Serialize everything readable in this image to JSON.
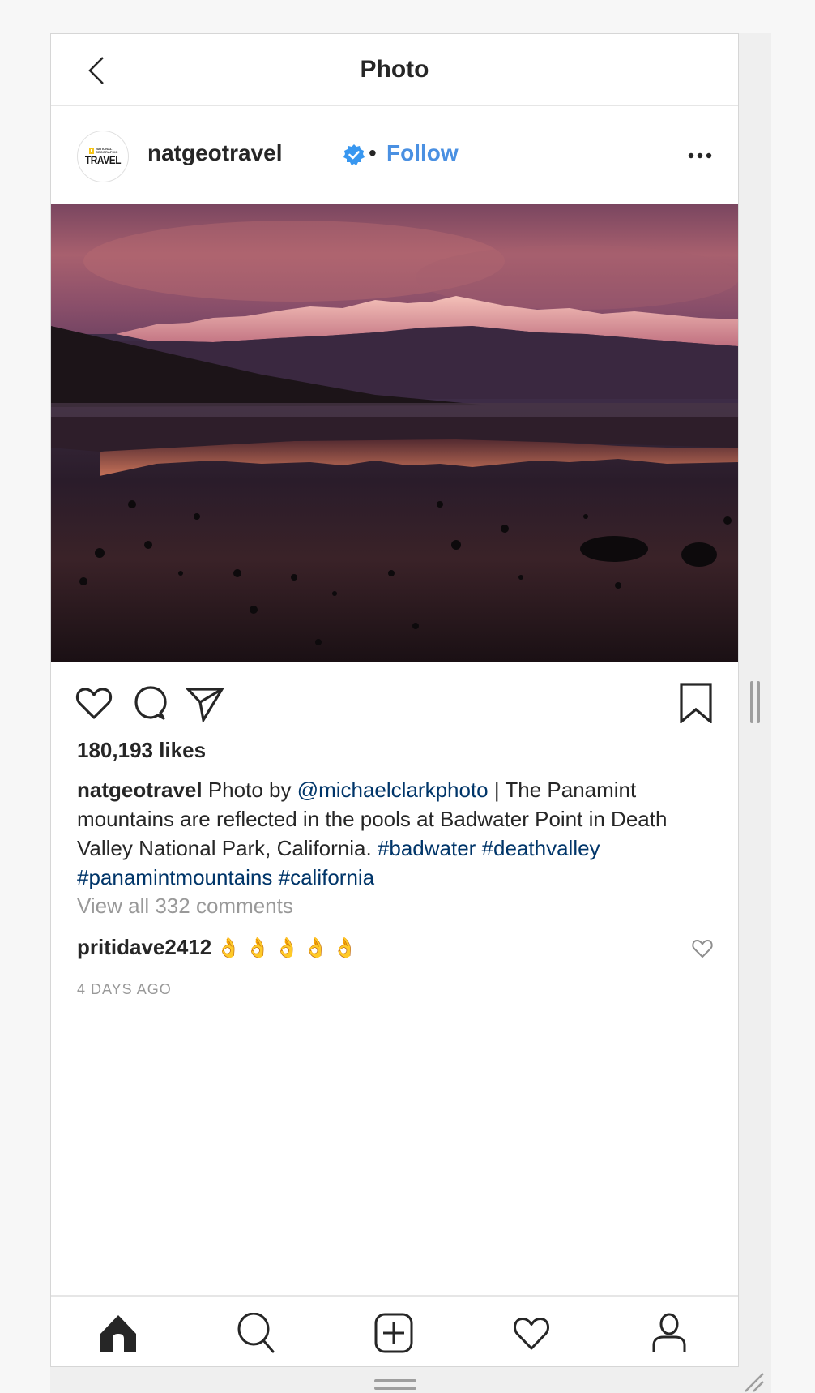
{
  "header": {
    "title": "Photo",
    "back_icon": "chevron-left-icon"
  },
  "post": {
    "account": {
      "avatar_text_top": "NATIONAL GEOGRAPHIC",
      "avatar_text_main": "TRAVEL",
      "username": "natgeotravel",
      "verified": true,
      "separator": "•",
      "follow_label": "Follow",
      "more_icon": "more-horizontal-icon"
    },
    "photo_alt": "Panamint mountains reflected in the pools at Badwater Point, Death Valley",
    "actions": {
      "like_icon": "heart-icon",
      "comment_icon": "comment-icon",
      "share_icon": "paper-plane-icon",
      "save_icon": "bookmark-icon"
    },
    "likes": "180,193 likes",
    "caption": {
      "username": "natgeotravel",
      "text_1": " Photo by ",
      "mention": "@michaelclarkphoto",
      "text_2": " | The Panamint mountains are reflected in the pools at Badwater Point in Death Valley National Park, California. ",
      "hashtags": [
        "#badwater",
        "#deathvalley",
        "#panamintmountains",
        "#california"
      ]
    },
    "view_all_comments": "View all 332 comments",
    "comments": [
      {
        "username": "pritidave2412",
        "text": "👌👌👌👌👌"
      }
    ],
    "timestamp": "4 DAYS AGO"
  },
  "bottom_nav": {
    "items": [
      {
        "name": "home",
        "icon": "home-icon",
        "active": true
      },
      {
        "name": "search",
        "icon": "search-icon",
        "active": false
      },
      {
        "name": "new-post",
        "icon": "plus-square-icon",
        "active": false
      },
      {
        "name": "activity",
        "icon": "heart-icon",
        "active": false
      },
      {
        "name": "profile",
        "icon": "user-icon",
        "active": false
      }
    ]
  },
  "colors": {
    "link_blue": "#4a90e2",
    "hashtag_blue": "#003569",
    "text": "#262626",
    "muted": "#999999",
    "verified_badge": "#3897f0"
  }
}
